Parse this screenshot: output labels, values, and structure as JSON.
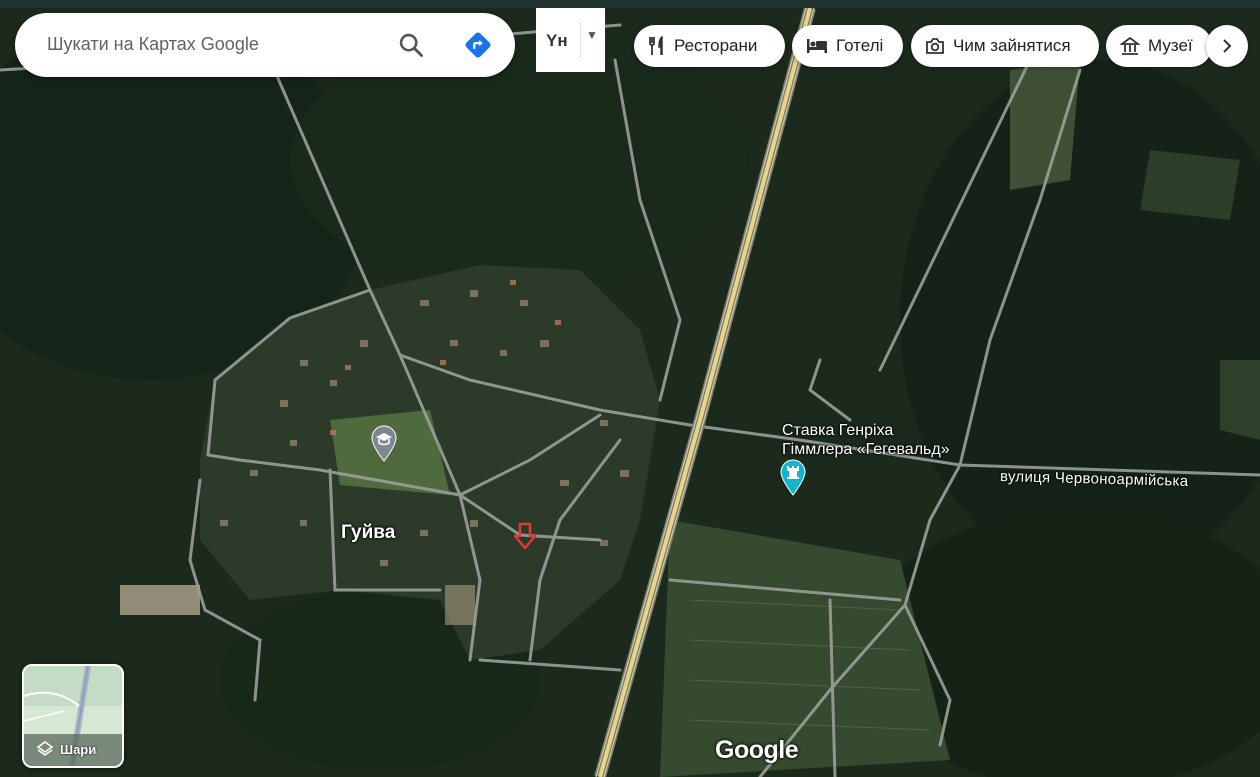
{
  "search": {
    "placeholder": "Шукати на Картах Google"
  },
  "language": {
    "label": "Yн"
  },
  "chips": [
    {
      "label": "Ресторани",
      "icon": "restaurant-icon"
    },
    {
      "label": "Готелі",
      "icon": "hotel-icon"
    },
    {
      "label": "Чим зайнятися",
      "icon": "camera-icon"
    },
    {
      "label": "Музеї",
      "icon": "museum-icon"
    }
  ],
  "map": {
    "village_label": "Гуйва",
    "poi": {
      "line1": "Ставка Генріха",
      "line2": "Гіммлера «Гегевальд»",
      "icon": "chess-rook-icon"
    },
    "street_label": "вулиця Червоноармійська",
    "school_icon": "school-icon",
    "marker_icon": "red-arrow-marker-icon"
  },
  "layers": {
    "label": "Шари"
  },
  "logo": {
    "text": "Google"
  },
  "colors": {
    "directions_blue": "#1a73e8",
    "marker_red": "#e53935",
    "poi_teal": "#12b5cb",
    "school_gray": "#7d8890"
  }
}
